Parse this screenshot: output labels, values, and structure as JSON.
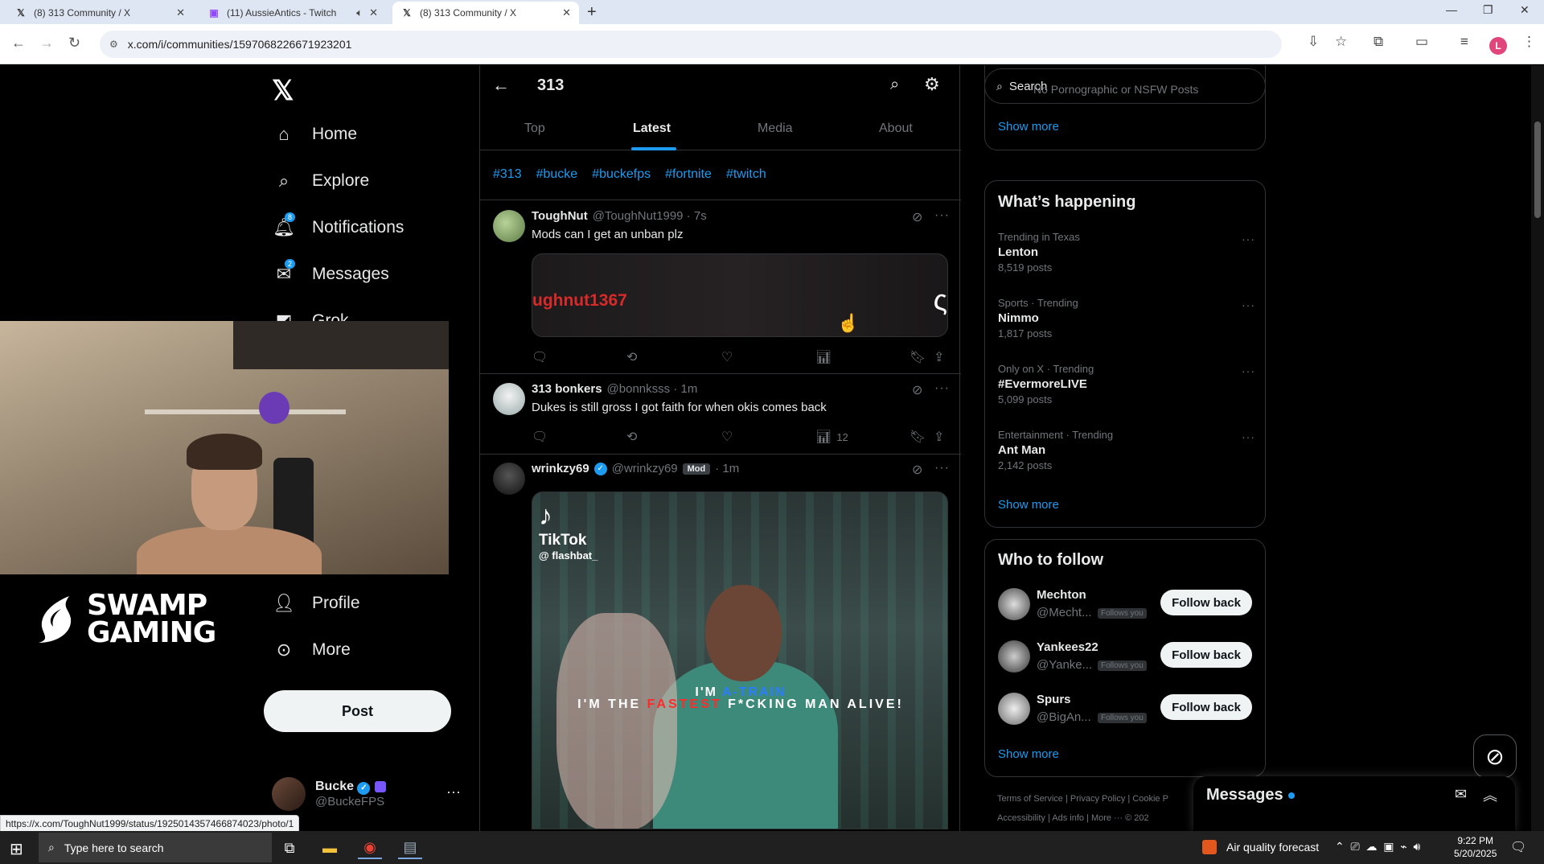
{
  "browser": {
    "tabs": [
      {
        "label": "(8) 313 Community / X",
        "icon": "x-icon",
        "active": false
      },
      {
        "label": "(11) AussieAntics - Twitch",
        "icon": "twitch-icon",
        "active": false
      },
      {
        "label": "(8) 313 Community / X",
        "icon": "x-icon",
        "active": true
      }
    ],
    "url": "x.com/i/communities/1597068226671923201",
    "status_url": "https://x.com/ToughNut1999/status/1925014357466874023/photo/1"
  },
  "nav": {
    "items": [
      {
        "label": "Home",
        "icon": "home-icon"
      },
      {
        "label": "Explore",
        "icon": "search-icon"
      },
      {
        "label": "Notifications",
        "icon": "bell-icon",
        "badge": "8"
      },
      {
        "label": "Messages",
        "icon": "mail-icon",
        "badge": "2"
      },
      {
        "label": "Grok",
        "icon": "grok-icon"
      },
      {
        "label": "Profile",
        "icon": "person-icon"
      },
      {
        "label": "More",
        "icon": "more-circle-icon"
      }
    ],
    "post_label": "Post",
    "account": {
      "name": "Bucke",
      "handle": "@BuckeFPS"
    }
  },
  "overlay": {
    "logo_line1": "SWAMP",
    "logo_line2": "GAMING"
  },
  "community": {
    "title": "313",
    "tabs": [
      "Top",
      "Latest",
      "Media",
      "About"
    ],
    "active_tab": "Latest",
    "hashtags": [
      "#313",
      "#bucke",
      "#buckefps",
      "#fortnite",
      "#twitch"
    ]
  },
  "tweets": [
    {
      "name": "ToughNut",
      "handle": "@ToughNut1999",
      "time": "7s",
      "text": "Mods can I get an unban plz",
      "media_text": "ughnut1367",
      "views": ""
    },
    {
      "name": "313 bonkers",
      "handle": "@bonnksss",
      "time": "1m",
      "text": "Dukes is still gross I got faith for when okis comes back",
      "views": "12"
    },
    {
      "name": "wrinkzy69",
      "handle": "@wrinkzy69",
      "badge": "Mod",
      "time": "1m",
      "media": {
        "tiktok_brand": "TikTok",
        "tiktok_user": "@ flashbat_",
        "caption1_a": "I'M ",
        "caption1_b": "A-TRAIN",
        "caption2_a": "I'M THE ",
        "caption2_b": "FASTEST",
        "caption2_c": " F*CKING MAN ALIVE!"
      }
    }
  ],
  "right": {
    "search_placeholder": "Search",
    "rules_partial": "No Pornographic or NSFW Posts",
    "show_more": "Show more",
    "happening_title": "What’s happening",
    "trends": [
      {
        "meta": "Trending in Texas",
        "title": "Lenton",
        "posts": "8,519 posts"
      },
      {
        "meta": "Sports · Trending",
        "title": "Nimmo",
        "posts": "1,817 posts"
      },
      {
        "meta": "Only on X · Trending",
        "title": "#EvermoreLIVE",
        "posts": "5,099 posts"
      },
      {
        "meta": "Entertainment · Trending",
        "title": "Ant Man",
        "posts": "2,142 posts"
      }
    ],
    "wtf_title": "Who to follow",
    "follows": [
      {
        "name": "Mechton",
        "handle": "@Mecht...",
        "tag": "Follows you",
        "button": "Follow back"
      },
      {
        "name": "Yankees22",
        "handle": "@Yanke...",
        "tag": "Follows you",
        "button": "Follow back"
      },
      {
        "name": "Spurs",
        "handle": "@BigAn...",
        "tag": "Follows you",
        "button": "Follow back"
      }
    ],
    "footer_line1": "Terms of Service  |  Privacy Policy  |  Cookie P",
    "footer_line2": "Accessibility  |  Ads info  |  More ···  © 202",
    "messages_label": "Messages"
  },
  "taskbar": {
    "search_placeholder": "Type here to search",
    "weather": "Air quality forecast",
    "time": "9:22 PM",
    "date": "5/20/2025"
  }
}
